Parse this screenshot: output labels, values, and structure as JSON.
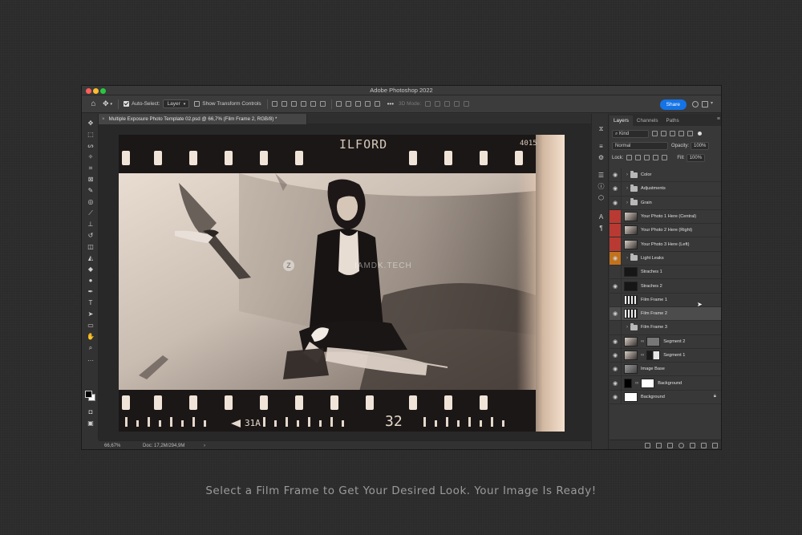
{
  "window": {
    "title": "Adobe Photoshop 2022"
  },
  "options_bar": {
    "auto_select_label": "Auto-Select:",
    "auto_select_value": "Layer",
    "show_transform_label": "Show Transform Controls",
    "mode_3d": "3D Mode:",
    "share_label": "Share"
  },
  "document": {
    "tab_title": "Multiple Exposure Photo Template 02.psd @ 66,7% (Film Frame 2, RGB/8) *",
    "close_glyph": "×"
  },
  "status": {
    "zoom": "66,67%",
    "doc": "Doc: 17,2M/294,9M",
    "arrow": "›"
  },
  "photo": {
    "brand": "ILFORD",
    "frame_top_right": "4015",
    "frame_bottom_left": "31A",
    "frame_bottom_number": "32",
    "watermark": "IAMDK.TECH"
  },
  "layers_panel": {
    "tabs": [
      "Layers",
      "Channels",
      "Paths"
    ],
    "filter_kind": "Kind",
    "blend_mode": "Normal",
    "opacity_label": "Opacity:",
    "opacity_value": "100%",
    "lock_label": "Lock:",
    "fill_label": "Fill:",
    "fill_value": "100%",
    "layers": [
      {
        "name": "Color",
        "type": "group",
        "eye": "normal"
      },
      {
        "name": "Adjustments",
        "type": "group",
        "eye": "normal"
      },
      {
        "name": "Grain",
        "type": "group",
        "eye": "normal"
      },
      {
        "name": "Your Photo 1 Here (Central)",
        "type": "photo",
        "eye": "red"
      },
      {
        "name": "Your Photo 2 Here (Right)",
        "type": "photo",
        "eye": "red"
      },
      {
        "name": "Your Photo 3 Here (Left)",
        "type": "photo",
        "eye": "red"
      },
      {
        "name": "Light Leaks",
        "type": "group",
        "eye": "orange"
      },
      {
        "name": "Straches 1",
        "type": "dark",
        "eye": "hidden"
      },
      {
        "name": "Straches 2",
        "type": "dark",
        "eye": "normal"
      },
      {
        "name": "Film Frame 1",
        "type": "film",
        "eye": "hidden"
      },
      {
        "name": "Film Frame 2",
        "type": "film",
        "eye": "normal",
        "selected": true
      },
      {
        "name": "Film Frame 3",
        "type": "group",
        "eye": "hidden"
      },
      {
        "name": "Segment 2",
        "type": "mask",
        "eye": "normal"
      },
      {
        "name": "Segment 1",
        "type": "mask",
        "eye": "normal"
      },
      {
        "name": "Image Base",
        "type": "base",
        "eye": "normal"
      },
      {
        "name": "Background",
        "type": "solid",
        "eye": "normal"
      },
      {
        "name": "Background",
        "type": "white",
        "eye": "normal",
        "locked": true
      }
    ]
  },
  "caption": "Select a Film Frame to Get Your Desired Look. Your Image Is Ready!"
}
